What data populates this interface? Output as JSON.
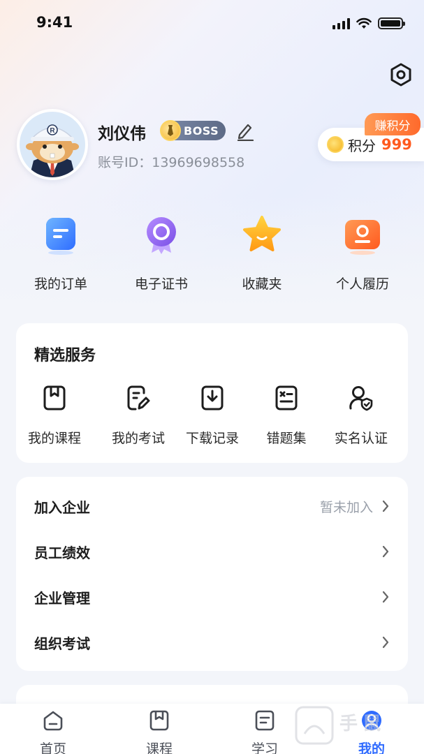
{
  "status_bar": {
    "time": "9:41"
  },
  "profile": {
    "name": "刘仪伟",
    "badge": "BOSS",
    "account_label": "账号ID：",
    "account_id": "13969698558"
  },
  "points": {
    "label": "积分",
    "value": "999",
    "earn_label": "赚积分"
  },
  "quick_actions": [
    {
      "label": "我的订单",
      "icon": "order-icon",
      "color": "#3d8bff"
    },
    {
      "label": "电子证书",
      "icon": "certificate-icon",
      "color": "#8f63f0"
    },
    {
      "label": "收藏夹",
      "icon": "star-icon",
      "color": "#ffab1a"
    },
    {
      "label": "个人履历",
      "icon": "resume-icon",
      "color": "#ff6b2c"
    }
  ],
  "services": {
    "title": "精选服务",
    "items": [
      {
        "label": "我的课程",
        "icon": "course-icon"
      },
      {
        "label": "我的考试",
        "icon": "exam-icon"
      },
      {
        "label": "下载记录",
        "icon": "download-icon"
      },
      {
        "label": "错题集",
        "icon": "wrong-questions-icon"
      },
      {
        "label": "实名认证",
        "icon": "verify-icon"
      }
    ]
  },
  "menu": [
    {
      "label": "加入企业",
      "value": "暂未加入"
    },
    {
      "label": "员工绩效",
      "value": ""
    },
    {
      "label": "企业管理",
      "value": ""
    },
    {
      "label": "组织考试",
      "value": ""
    }
  ],
  "tabbar": {
    "items": [
      {
        "label": "首页",
        "icon": "home-icon",
        "active": false
      },
      {
        "label": "课程",
        "icon": "course-icon",
        "active": false
      },
      {
        "label": "学习",
        "icon": "study-icon",
        "active": false
      },
      {
        "label": "我的",
        "icon": "profile-icon",
        "active": true
      }
    ],
    "accent": "#2f6bff"
  }
}
